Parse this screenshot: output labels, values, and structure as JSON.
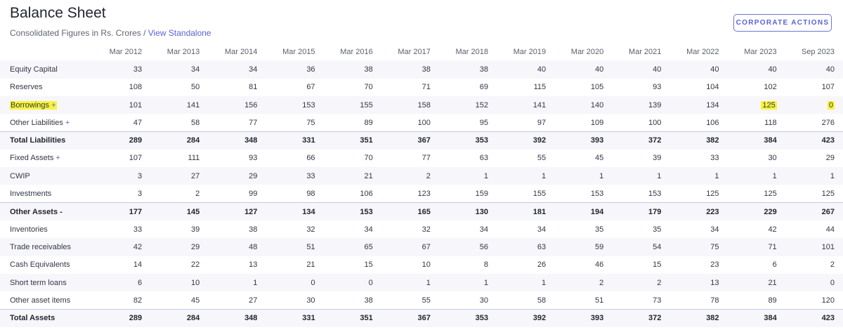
{
  "page": {
    "title": "Balance Sheet",
    "subtitle_prefix": "Consolidated Figures in Rs. Crores / ",
    "subtitle_link": "View Standalone",
    "action_button": "CORPORATE ACTIONS"
  },
  "table": {
    "columns": [
      "Mar 2012",
      "Mar 2013",
      "Mar 2014",
      "Mar 2015",
      "Mar 2016",
      "Mar 2017",
      "Mar 2018",
      "Mar 2019",
      "Mar 2020",
      "Mar 2021",
      "Mar 2022",
      "Mar 2023",
      "Sep 2023"
    ],
    "rows": [
      {
        "label": "Equity Capital",
        "expand": "",
        "values": [
          "33",
          "34",
          "34",
          "36",
          "38",
          "38",
          "38",
          "40",
          "40",
          "40",
          "40",
          "40",
          "40"
        ]
      },
      {
        "label": "Reserves",
        "expand": "",
        "values": [
          "108",
          "50",
          "81",
          "67",
          "70",
          "71",
          "69",
          "115",
          "105",
          "93",
          "104",
          "102",
          "107"
        ]
      },
      {
        "label": "Borrowings",
        "expand": "+",
        "values": [
          "101",
          "141",
          "156",
          "153",
          "155",
          "158",
          "152",
          "141",
          "140",
          "139",
          "134",
          "125",
          "0"
        ]
      },
      {
        "label": "Other Liabilities",
        "expand": "+",
        "values": [
          "47",
          "58",
          "77",
          "75",
          "89",
          "100",
          "95",
          "97",
          "109",
          "100",
          "106",
          "118",
          "276"
        ]
      },
      {
        "label": "Total Liabilities",
        "expand": "",
        "values": [
          "289",
          "284",
          "348",
          "331",
          "351",
          "367",
          "353",
          "392",
          "393",
          "372",
          "382",
          "384",
          "423"
        ]
      },
      {
        "label": "Fixed Assets",
        "expand": "+",
        "values": [
          "107",
          "111",
          "93",
          "66",
          "70",
          "77",
          "63",
          "55",
          "45",
          "39",
          "33",
          "30",
          "29"
        ]
      },
      {
        "label": "CWIP",
        "expand": "",
        "values": [
          "3",
          "27",
          "29",
          "33",
          "21",
          "2",
          "1",
          "1",
          "1",
          "1",
          "1",
          "1",
          "1"
        ]
      },
      {
        "label": "Investments",
        "expand": "",
        "values": [
          "3",
          "2",
          "99",
          "98",
          "106",
          "123",
          "159",
          "155",
          "153",
          "153",
          "125",
          "125",
          "125"
        ]
      },
      {
        "label": "Other Assets",
        "expand": "-",
        "values": [
          "177",
          "145",
          "127",
          "134",
          "153",
          "165",
          "130",
          "181",
          "194",
          "179",
          "223",
          "229",
          "267"
        ]
      },
      {
        "label": "Inventories",
        "expand": "",
        "values": [
          "33",
          "39",
          "38",
          "32",
          "34",
          "32",
          "34",
          "34",
          "35",
          "35",
          "34",
          "42",
          "44"
        ]
      },
      {
        "label": "Trade receivables",
        "expand": "",
        "values": [
          "42",
          "29",
          "48",
          "51",
          "65",
          "67",
          "56",
          "63",
          "59",
          "54",
          "75",
          "71",
          "101"
        ]
      },
      {
        "label": "Cash Equivalents",
        "expand": "",
        "values": [
          "14",
          "22",
          "13",
          "21",
          "15",
          "10",
          "8",
          "26",
          "46",
          "15",
          "23",
          "6",
          "2"
        ]
      },
      {
        "label": "Short term loans",
        "expand": "",
        "values": [
          "6",
          "10",
          "1",
          "0",
          "0",
          "1",
          "1",
          "1",
          "2",
          "2",
          "13",
          "21",
          "0"
        ]
      },
      {
        "label": "Other asset items",
        "expand": "",
        "values": [
          "82",
          "45",
          "27",
          "30",
          "38",
          "55",
          "30",
          "58",
          "51",
          "73",
          "78",
          "89",
          "120"
        ]
      },
      {
        "label": "Total Assets",
        "expand": "",
        "values": [
          "289",
          "284",
          "348",
          "331",
          "351",
          "367",
          "353",
          "392",
          "393",
          "372",
          "382",
          "384",
          "423"
        ]
      }
    ]
  },
  "highlight_color": "#f7f43c",
  "accent_color": "#5a62d8"
}
